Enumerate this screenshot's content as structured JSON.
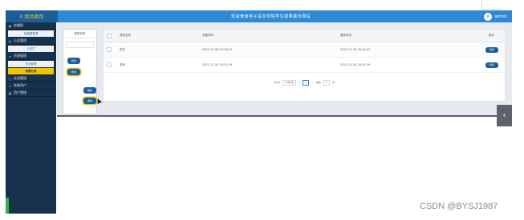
{
  "header": {
    "logo_text": "后台首页",
    "title": "欢迎使用电子信息学院学生成果展示网站",
    "user": "admin",
    "avatar_letter": "A"
  },
  "sidebar": {
    "groups": [
      {
        "label": "轮播图",
        "icon": "image-icon"
      },
      {
        "label": "轮播图管理",
        "sub": true
      },
      {
        "label": "公告管理",
        "icon": "notice-icon"
      },
      {
        "label": "公告栏",
        "sub": true
      },
      {
        "label": "资源管理",
        "icon": "folder-icon"
      },
      {
        "label": "作品管理",
        "sub": true
      },
      {
        "label": "资源分类",
        "sub": true,
        "active": true
      },
      {
        "label": "交流管理",
        "icon": "chat-icon"
      },
      {
        "label": "系统用户",
        "icon": "user-icon"
      },
      {
        "label": "用户管理",
        "icon": "users-icon"
      }
    ]
  },
  "tree": {
    "header": "类型名称",
    "buttons": [
      "新建",
      "修改",
      "删除",
      "添加"
    ]
  },
  "table": {
    "columns": [
      "类型名称",
      "创建时间",
      "更新时间",
      "操作"
    ],
    "rows": [
      {
        "name": "学生",
        "created": "2022-11-18 20:16:47",
        "updated": "2022-11-18 20:16:47",
        "op": "详情"
      },
      {
        "name": "老师",
        "created": "2022-11-18 20:31:29",
        "updated": "2022-11-18 20:31:29",
        "op": "详情"
      }
    ]
  },
  "pagination": {
    "total": "共2条",
    "per_page": "10条/页",
    "prev": "<",
    "page": "1",
    "next": ">",
    "goto_label": "前往",
    "goto_value": "1",
    "goto_suffix": "页"
  },
  "float_tab": {
    "icon": "chevron-left-icon",
    "glyph": "‹"
  },
  "watermark": "CSDN @BYSJ1987",
  "colors": {
    "topbar": "#2e8ad6",
    "sidebar": "#17324d",
    "accent": "#f5c400",
    "button": "#1b5e98"
  }
}
